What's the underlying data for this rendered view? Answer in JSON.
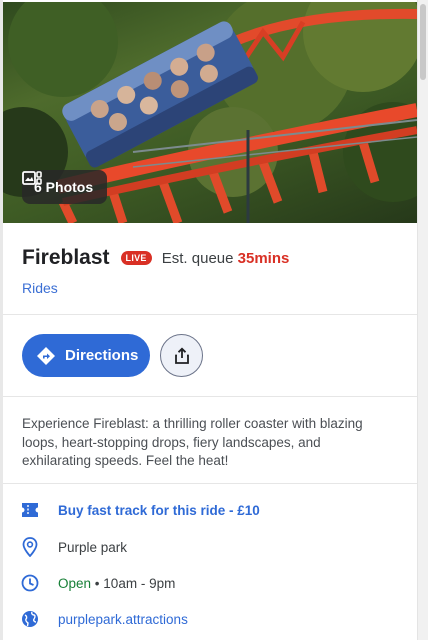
{
  "photos": {
    "label": "6 Photos",
    "icon": "photo-gallery-icon"
  },
  "attraction": {
    "name": "Fireblast",
    "live_badge": "LIVE",
    "queue_prefix": "Est. queue",
    "queue_value": "35mins",
    "category": "Rides"
  },
  "actions": {
    "directions_label": "Directions",
    "directions_icon": "directions-icon",
    "share_icon": "share-icon"
  },
  "description": "Experience Fireblast: a thrilling roller coaster with blazing loops, heart-stopping drops, fiery landscapes, and exhilarating speeds. Feel the heat!",
  "details": {
    "fast_track": "Buy fast track for this ride - £10",
    "location": "Purple park",
    "status": "Open",
    "separator": "•",
    "hours": "10am - 9pm",
    "website": "purplepark.attractions"
  },
  "colors": {
    "accent": "#2f6ad6",
    "live": "#d93025",
    "open": "#188038"
  }
}
